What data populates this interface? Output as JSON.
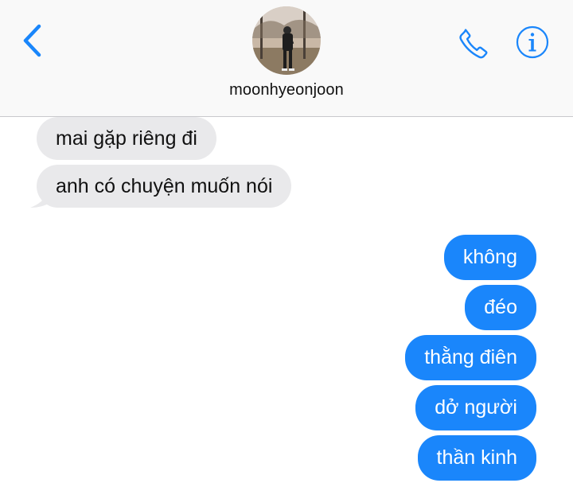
{
  "header": {
    "contact_name": "moonhyeonjoon",
    "icons": {
      "back": "chevron-left-icon",
      "call": "phone-icon",
      "info": "info-icon"
    },
    "accent_color": "#1a86fb"
  },
  "messages": [
    {
      "direction": "incoming",
      "text": "mai gặp riêng đi"
    },
    {
      "direction": "incoming",
      "text": "anh có chuyện muốn nói"
    },
    {
      "direction": "outgoing",
      "text": "không"
    },
    {
      "direction": "outgoing",
      "text": "đéo"
    },
    {
      "direction": "outgoing",
      "text": "thằng điên"
    },
    {
      "direction": "outgoing",
      "text": "dở người"
    },
    {
      "direction": "outgoing",
      "text": "thần kinh"
    }
  ]
}
